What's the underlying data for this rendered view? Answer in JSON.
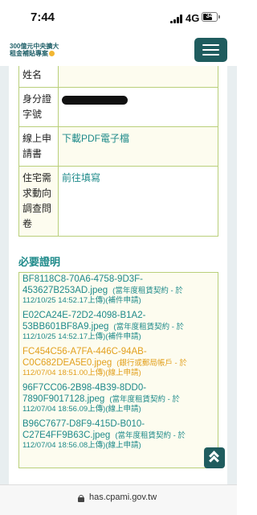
{
  "status_bar": {
    "time": "7:44",
    "network": "4G",
    "battery": "34"
  },
  "header": {
    "logo_line1": "300億元中央擴大",
    "logo_line2": "租金補貼專案"
  },
  "info_rows": [
    {
      "label": "姓名",
      "value": ""
    },
    {
      "label": "身分證字號",
      "value": ""
    },
    {
      "label": "線上申請書",
      "value": "下載PDF電子檔"
    },
    {
      "label": "住宅需求動向調查問卷",
      "value": "前往填寫"
    }
  ],
  "certificates": {
    "title": "必要證明",
    "items": [
      {
        "file": "BF8118C8-70A6-4758-9D3F-453627B253AD.jpeg",
        "type": "(當年度租賃契約 - 於",
        "date": "112/10/25 14:52.17上傳)",
        "status": "(補件申請)"
      },
      {
        "file": "E02CA24E-72D2-4098-B1A2-53BB601BF8A9.jpeg",
        "type": "(當年度租賃契約 - 於",
        "date": "112/10/25 14:52.17上傳)",
        "status": "(補件申請)"
      },
      {
        "file": "FC454C56-A7FA-446C-94AB-C0C682DEA5E0.jpeg",
        "type": "(銀行或郵局帳戶 - 於",
        "date": "112/07/04 18:51.00上傳)",
        "status": "(線上申請)"
      },
      {
        "file": "96F7CC06-2B98-4B39-8DD0-7890F9017128.jpeg",
        "type": "(當年度租賃契約 - 於",
        "date": "112/07/04 18:56.09上傳)",
        "status": "(線上申請)"
      },
      {
        "file": "B96C7677-D8F9-415D-B010-C27E4FF9B63C.jpeg",
        "type": "(當年度租賃契約 - 於",
        "date": "112/07/04 18:56.08上傳)",
        "status": "(線上申請)"
      }
    ]
  },
  "url_bar": {
    "url": "has.cpami.gov.tw"
  },
  "colors": {
    "accent": "#1e8a8a",
    "brand_dark": "#1f5c5e",
    "warning": "#e2a01e",
    "table_border": "#b9cf7a",
    "table_fill": "#fdfcef"
  }
}
